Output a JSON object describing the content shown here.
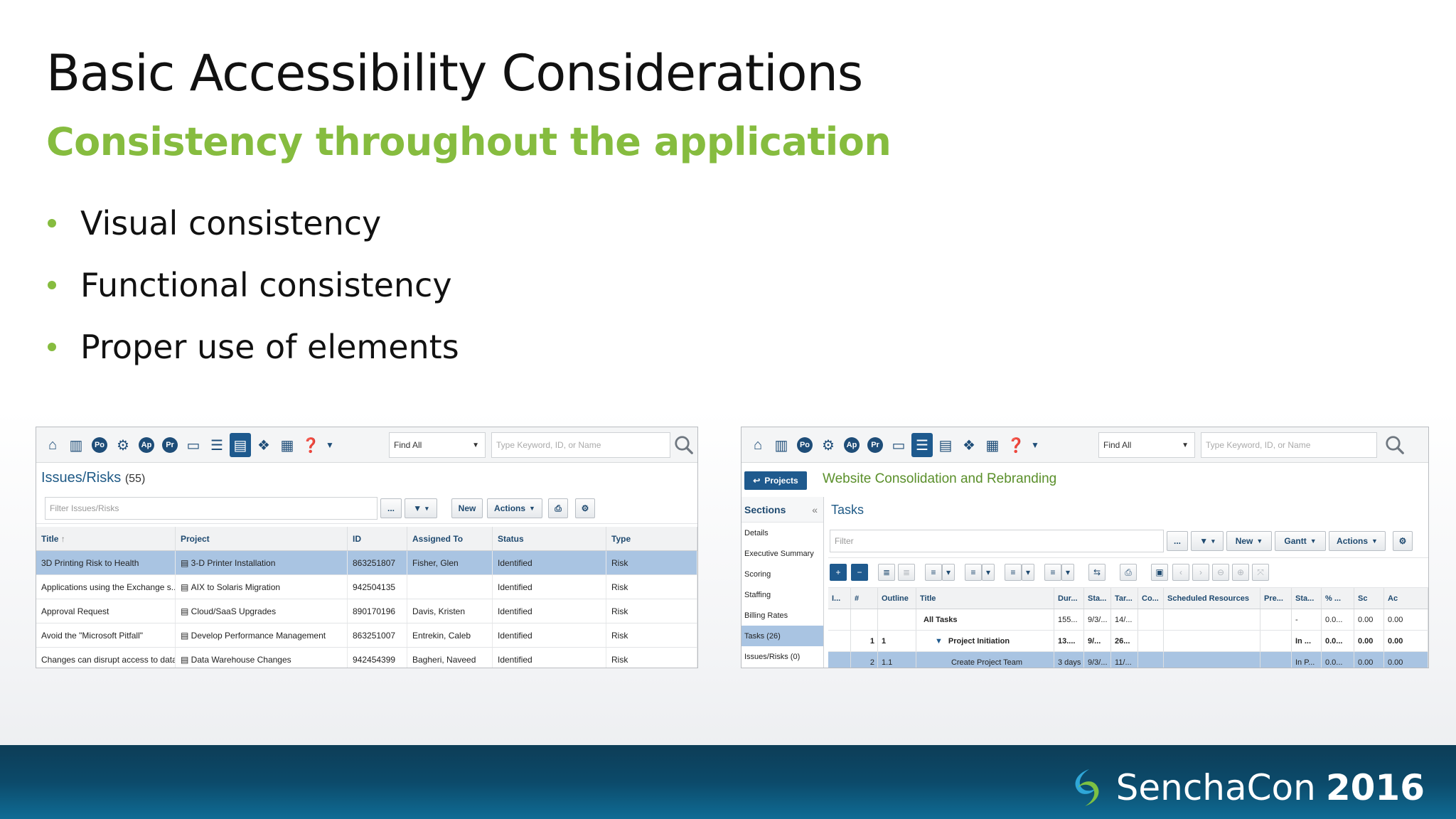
{
  "slide": {
    "title": "Basic Accessibility Considerations",
    "subtitle": "Consistency throughout the application",
    "bullets": [
      "Visual consistency",
      "Functional consistency",
      "Proper use of elements"
    ]
  },
  "footer": {
    "brand": "SenchaCon",
    "year": "2016"
  },
  "colors": {
    "accent_green": "#86bc3f",
    "app_blue": "#1f5a8e",
    "selected_row": "#a9c4e2",
    "footer_blue": "#0c4a6a"
  },
  "left_app": {
    "toolbar": {
      "icons": [
        "home-icon",
        "building-icon",
        "po-icon",
        "gears-icon",
        "ap-icon",
        "pr-icon",
        "inbox-icon",
        "list-icon",
        "notes-icon",
        "cubes-icon",
        "map-icon",
        "help-icon",
        "caret-down-icon"
      ],
      "circle_labels": {
        "po": "Po",
        "ap": "Ap",
        "pr": "Pr"
      },
      "find_select": "Find All",
      "keyword_placeholder": "Type Keyword, ID, or Name"
    },
    "title": "Issues/Risks",
    "count": "(55)",
    "filter_placeholder": "Filter Issues/Risks",
    "buttons": {
      "ellipsis": "...",
      "new": "New",
      "actions": "Actions"
    },
    "columns": [
      "Title",
      "Project",
      "ID",
      "Assigned To",
      "Status",
      "Type"
    ],
    "rows": [
      {
        "title": "3D Printing Risk to Health",
        "project": "3-D Printer Installation",
        "id": "863251807",
        "assigned": "Fisher, Glen",
        "status": "Identified",
        "type": "Risk"
      },
      {
        "title": "Applications using the Exchange s...",
        "project": "AIX to Solaris Migration",
        "id": "942504135",
        "assigned": "",
        "status": "Identified",
        "type": "Risk"
      },
      {
        "title": "Approval Request",
        "project": "Cloud/SaaS Upgrades",
        "id": "890170196",
        "assigned": "Davis, Kristen",
        "status": "Identified",
        "type": "Risk"
      },
      {
        "title": "Avoid the \"Microsoft Pitfall\"",
        "project": "Develop Performance Management",
        "id": "863251007",
        "assigned": "Entrekin, Caleb",
        "status": "Identified",
        "type": "Risk"
      },
      {
        "title": "Changes can disrupt access to data",
        "project": "Data Warehouse Changes",
        "id": "942454399",
        "assigned": "Bagheri, Naveed",
        "status": "Identified",
        "type": "Risk"
      }
    ]
  },
  "right_app": {
    "toolbar": {
      "find_select": "Find All",
      "keyword_placeholder": "Type Keyword, ID, or Name"
    },
    "projects_button": "Projects",
    "project_title": "Website Consolidation and Rebranding",
    "sections_title": "Sections",
    "sections_collapse": "«",
    "sections": [
      "Details",
      "Executive Summary",
      "Scoring",
      "Staffing",
      "Billing Rates",
      "Tasks (26)",
      "Issues/Risks (0)"
    ],
    "tasks_title": "Tasks",
    "filter_placeholder": "Filter",
    "buttons": {
      "ellipsis": "...",
      "new": "New",
      "gantt": "Gantt",
      "actions": "Actions"
    },
    "columns": [
      "I...",
      "#",
      "Outline",
      "Title",
      "Dur...",
      "Sta...",
      "Tar...",
      "Co...",
      "Scheduled Resources",
      "Pre...",
      "Sta...",
      "% ...",
      "Sc",
      "Ac"
    ],
    "rows": [
      {
        "i": "",
        "num": "",
        "outline": "",
        "title": "All Tasks",
        "dur": "155...",
        "start": "9/3/...",
        "target": "14/...",
        "co": "",
        "res": "",
        "pre": "",
        "status": "-",
        "pct": "0.0...",
        "sc": "0.00",
        "ac": "0.00"
      },
      {
        "i": "",
        "num": "1",
        "outline": "1",
        "title": "Project Initiation",
        "dur": "13....",
        "start": "9/...",
        "target": "26...",
        "co": "",
        "res": "",
        "pre": "",
        "status": "In ...",
        "pct": "0.0...",
        "sc": "0.00",
        "ac": "0.00"
      },
      {
        "i": "",
        "num": "2",
        "outline": "1.1",
        "title": "Create Project Team",
        "dur": "3 days",
        "start": "9/3/...",
        "target": "11/...",
        "co": "",
        "res": "",
        "pre": "",
        "status": "In P...",
        "pct": "0.0...",
        "sc": "0.00",
        "ac": "0.00"
      }
    ]
  }
}
